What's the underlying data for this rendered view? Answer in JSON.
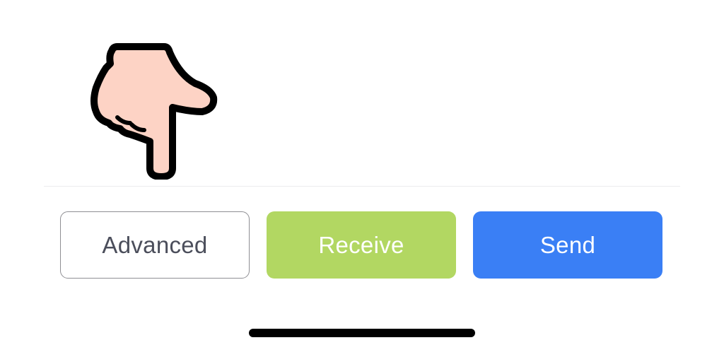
{
  "pointer": {
    "icon": "pointing-down-hand-icon"
  },
  "actions": {
    "advanced_label": "Advanced",
    "receive_label": "Receive",
    "send_label": "Send"
  },
  "colors": {
    "receive": "#b2d762",
    "send": "#3a7ff5",
    "outline": "#8e8e93",
    "skin": "#fdd3c5"
  }
}
